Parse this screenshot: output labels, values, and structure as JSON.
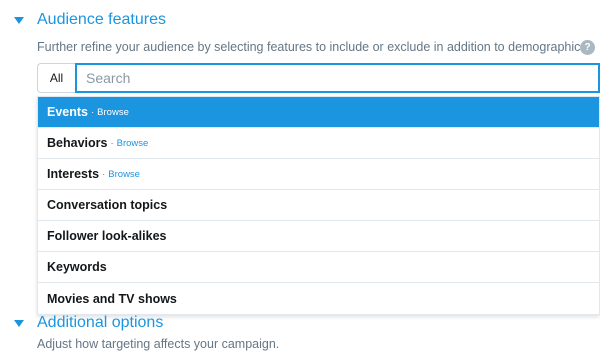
{
  "audience_features": {
    "title": "Audience features",
    "description": "Further refine your audience by selecting features to include or exclude in addition to demographics.",
    "help_icon": "?",
    "filter_button": "All",
    "search_placeholder": "Search"
  },
  "dropdown": {
    "items": [
      {
        "label": "Events",
        "browse": "Browse",
        "active": true
      },
      {
        "label": "Behaviors",
        "browse": "Browse"
      },
      {
        "label": "Interests",
        "browse": "Browse"
      },
      {
        "label": "Conversation topics"
      },
      {
        "label": "Follower look-alikes"
      },
      {
        "label": "Keywords"
      },
      {
        "label": "Movies and TV shows"
      }
    ]
  },
  "additional_options": {
    "title": "Additional options",
    "description": "Adjust how targeting affects your campaign."
  },
  "colors": {
    "accent": "#1b95e0",
    "muted_text": "#657786"
  }
}
